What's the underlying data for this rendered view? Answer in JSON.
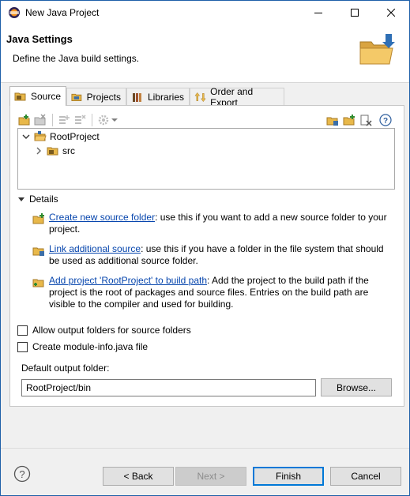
{
  "window": {
    "title": "New Java Project"
  },
  "banner": {
    "heading": "Java Settings",
    "description": "Define the Java build settings."
  },
  "tabs": [
    {
      "label": "Source",
      "active": true
    },
    {
      "label": "Projects",
      "active": false
    },
    {
      "label": "Libraries",
      "active": false
    },
    {
      "label": "Order and Export",
      "active": false
    }
  ],
  "tree": {
    "root": "RootProject",
    "child": "src"
  },
  "details": {
    "header": "Details",
    "items": [
      {
        "link": "Create new source folder",
        "text": ": use this if you want to add a new source folder to your project."
      },
      {
        "link": "Link additional source",
        "text": ": use this if you have a folder in the file system that should be used as additional source folder."
      },
      {
        "link": "Add project 'RootProject' to build path",
        "text": ": Add the project to the build path if the project is the root of packages and source files. Entries on the build path are visible to the compiler and used for building."
      }
    ]
  },
  "options": {
    "allow_output_folders": "Allow output folders for source folders",
    "create_module_info": "Create module-info.java file"
  },
  "output": {
    "label": "Default output folder:",
    "value": "RootProject/bin",
    "browse": "Browse..."
  },
  "footer": {
    "back": "< Back",
    "next": "Next >",
    "finish": "Finish",
    "cancel": "Cancel"
  },
  "colors": {
    "accent": "#0078d7",
    "link": "#0645ad",
    "folder": "#e8b84a"
  }
}
